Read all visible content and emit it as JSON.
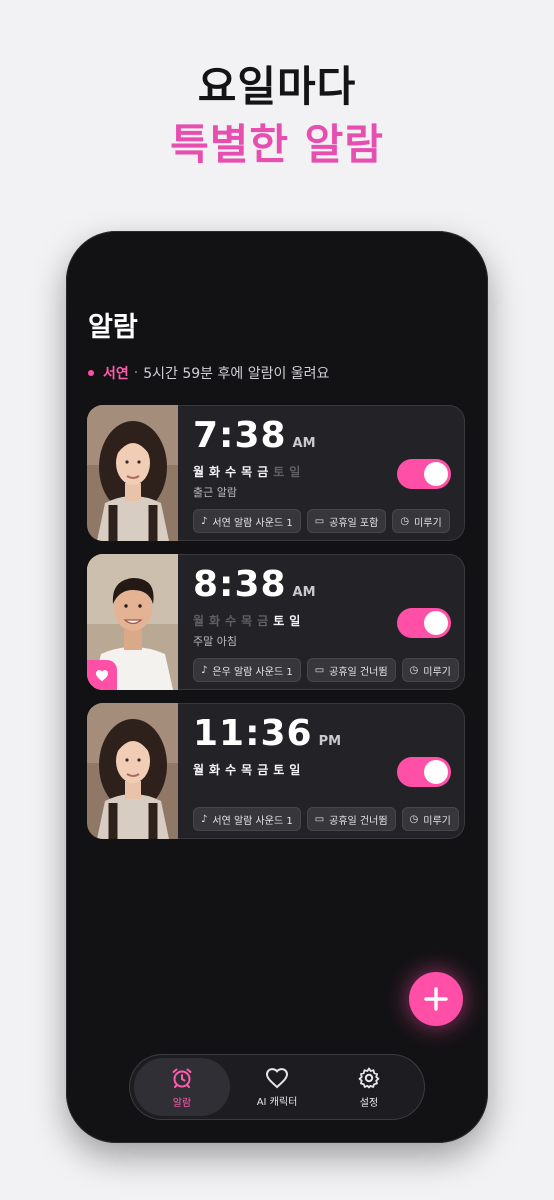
{
  "promo": {
    "line1": "요일마다",
    "line2": "특별한 알람"
  },
  "screen": {
    "title": "알람",
    "next_alarm": {
      "character": "서연",
      "separator": "·",
      "message": "5시간 59분 후에 알람이 울려요"
    }
  },
  "alarms": [
    {
      "time": "7:38",
      "ampm": "AM",
      "days": [
        {
          "d": "월",
          "on": true
        },
        {
          "d": "화",
          "on": true
        },
        {
          "d": "수",
          "on": true
        },
        {
          "d": "목",
          "on": true
        },
        {
          "d": "금",
          "on": true
        },
        {
          "d": "토",
          "on": false
        },
        {
          "d": "일",
          "on": false
        }
      ],
      "label": "출근 알람",
      "enabled": true,
      "chips": [
        "서연 알람 사운드 1",
        "공휴일 포함",
        "미루기"
      ]
    },
    {
      "time": "8:38",
      "ampm": "AM",
      "days": [
        {
          "d": "월",
          "on": false
        },
        {
          "d": "화",
          "on": false
        },
        {
          "d": "수",
          "on": false
        },
        {
          "d": "목",
          "on": false
        },
        {
          "d": "금",
          "on": false
        },
        {
          "d": "토",
          "on": true
        },
        {
          "d": "일",
          "on": true
        }
      ],
      "label": "주말 아침",
      "enabled": true,
      "chips": [
        "은우 알람 사운드 1",
        "공휴일 건너뜀",
        "미루기"
      ]
    },
    {
      "time": "11:36",
      "ampm": "PM",
      "days": [
        {
          "d": "월",
          "on": true
        },
        {
          "d": "화",
          "on": true
        },
        {
          "d": "수",
          "on": true
        },
        {
          "d": "목",
          "on": true
        },
        {
          "d": "금",
          "on": true
        },
        {
          "d": "토",
          "on": true
        },
        {
          "d": "일",
          "on": true
        }
      ],
      "label": "",
      "enabled": true,
      "chips": [
        "서연 알람 사운드 1",
        "공휴일 건너뜀",
        "미루기"
      ]
    }
  ],
  "tabs": [
    {
      "label": "알람",
      "icon": "alarm-clock-icon",
      "active": true
    },
    {
      "label": "AI 캐릭터",
      "icon": "heart-icon",
      "active": false
    },
    {
      "label": "설정",
      "icon": "gear-icon",
      "active": false
    }
  ],
  "colors": {
    "accent": "#ff4fa6",
    "background": "#121214",
    "card": "#232327"
  }
}
